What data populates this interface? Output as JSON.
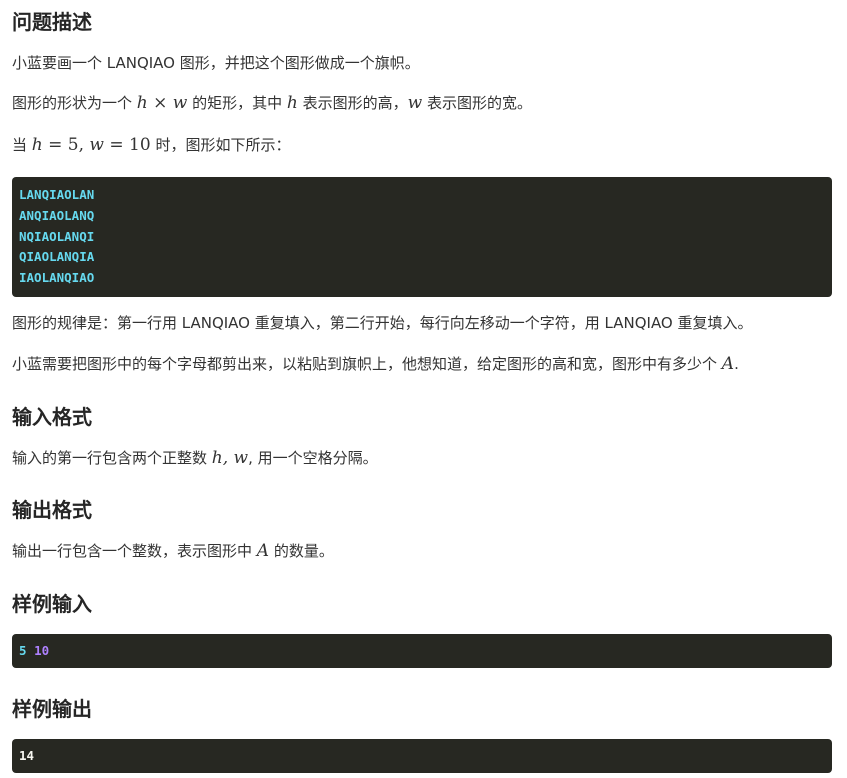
{
  "section_description": {
    "heading": "问题描述",
    "para1": "小蓝要画一个 LANQIAO 图形，并把这个图形做成一个旗帜。",
    "para2": {
      "a": "图形的形状为一个 ",
      "h": "h",
      "times": " × ",
      "w": "w",
      "b": " 的矩形，其中 ",
      "h2": "h",
      "c": " 表示图形的高，",
      "w2": "w",
      "d": " 表示图形的宽。"
    },
    "para3": {
      "a": "当 ",
      "h": "h",
      "eq1": " = 5, ",
      "w": "w",
      "eq2": " = 10",
      "b": " 时，图形如下所示："
    },
    "pattern_lines": [
      "LANQIAOLAN",
      "ANQIAOLANQ",
      "NQIAOLANQI",
      "QIAOLANQIA",
      "IAOLANQIAO"
    ],
    "para4": "图形的规律是：第一行用 LANQIAO 重复填入，第二行开始，每行向左移动一个字符，用 LANQIAO 重复填入。",
    "para5": {
      "a": "小蓝需要把图形中的每个字母都剪出来，以粘贴到旗帜上，他想知道，给定图形的高和宽，图形中有多少个 ",
      "A": "A",
      "b": "."
    }
  },
  "section_input": {
    "heading": "输入格式",
    "para": {
      "a": "输入的第一行包含两个正整数 ",
      "hw": "h, w",
      "b": ", 用一个空格分隔。"
    }
  },
  "section_output": {
    "heading": "输出格式",
    "para": {
      "a": "输出一行包含一个整数，表示图形中 ",
      "A": "A",
      "b": " 的数量。"
    }
  },
  "sample_input": {
    "heading": "样例输入",
    "n1": "5",
    "n2": "10"
  },
  "sample_output": {
    "heading": "样例输出",
    "value": "14"
  },
  "colors": {
    "code_bg": "#272822",
    "code_cyan": "#66d9ef",
    "code_purple": "#ae81ff",
    "code_white": "#f8f8f2"
  }
}
